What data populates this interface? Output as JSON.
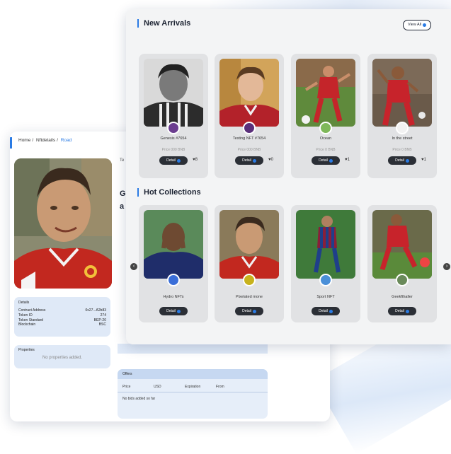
{
  "back_panel": {
    "breadcrumb": [
      "Home",
      "Nftdetails",
      "Road"
    ],
    "header_partial": "Te",
    "title_partial": "G",
    "subtitle_partial": "a",
    "details": {
      "title": "Details",
      "rows": [
        {
          "label": "Contract Address",
          "value": "0x27...A2b83"
        },
        {
          "label": "Token ID",
          "value": "274"
        },
        {
          "label": "Token Standard",
          "value": "BEP-20"
        },
        {
          "label": "Blockchain",
          "value": "BSC"
        }
      ]
    },
    "properties": {
      "title": "Properties",
      "empty": "No properties added."
    },
    "offers": {
      "title": "Offers",
      "columns": [
        "Price",
        "USD",
        "Expiration",
        "From"
      ],
      "empty": "No bids added so far"
    }
  },
  "new_arrivals": {
    "title": "New Arrivals",
    "view_all": "View All",
    "items": [
      {
        "name": "Genesis #7654",
        "price": "Price 000 BNB",
        "button": "Detail",
        "likes": "8",
        "avatar_color": "#6b3d8f"
      },
      {
        "name": "Testing NFT #7654",
        "price": "Price 000 BNB",
        "button": "Detail",
        "likes": "0",
        "avatar_color": "#5a2f7a"
      },
      {
        "name": "Ocean",
        "price": "Price 0 BNB",
        "button": "Detail",
        "likes": "1",
        "avatar_color": "#7fb85a"
      },
      {
        "name": "In the street",
        "price": "Price 0 BNB",
        "button": "Detail",
        "likes": "1",
        "avatar_color": "#f2f2f2"
      }
    ]
  },
  "hot_collections": {
    "title": "Hot Collections",
    "items": [
      {
        "name": "Hydro NFTs",
        "button": "Detail",
        "avatar_color": "#3a6ed8"
      },
      {
        "name": "Pixelated mone",
        "button": "Detail",
        "avatar_color": "#c7b21c"
      },
      {
        "name": "Sport NFT",
        "button": "Detail",
        "avatar_color": "#4a8fd8"
      },
      {
        "name": "Geekfthaller",
        "button": "Detail",
        "avatar_color": "#6a8a5a"
      }
    ]
  },
  "colors": {
    "accent": "#2a7be4",
    "button": "#2b2f36",
    "panel_bg": "#f3f4f5"
  }
}
